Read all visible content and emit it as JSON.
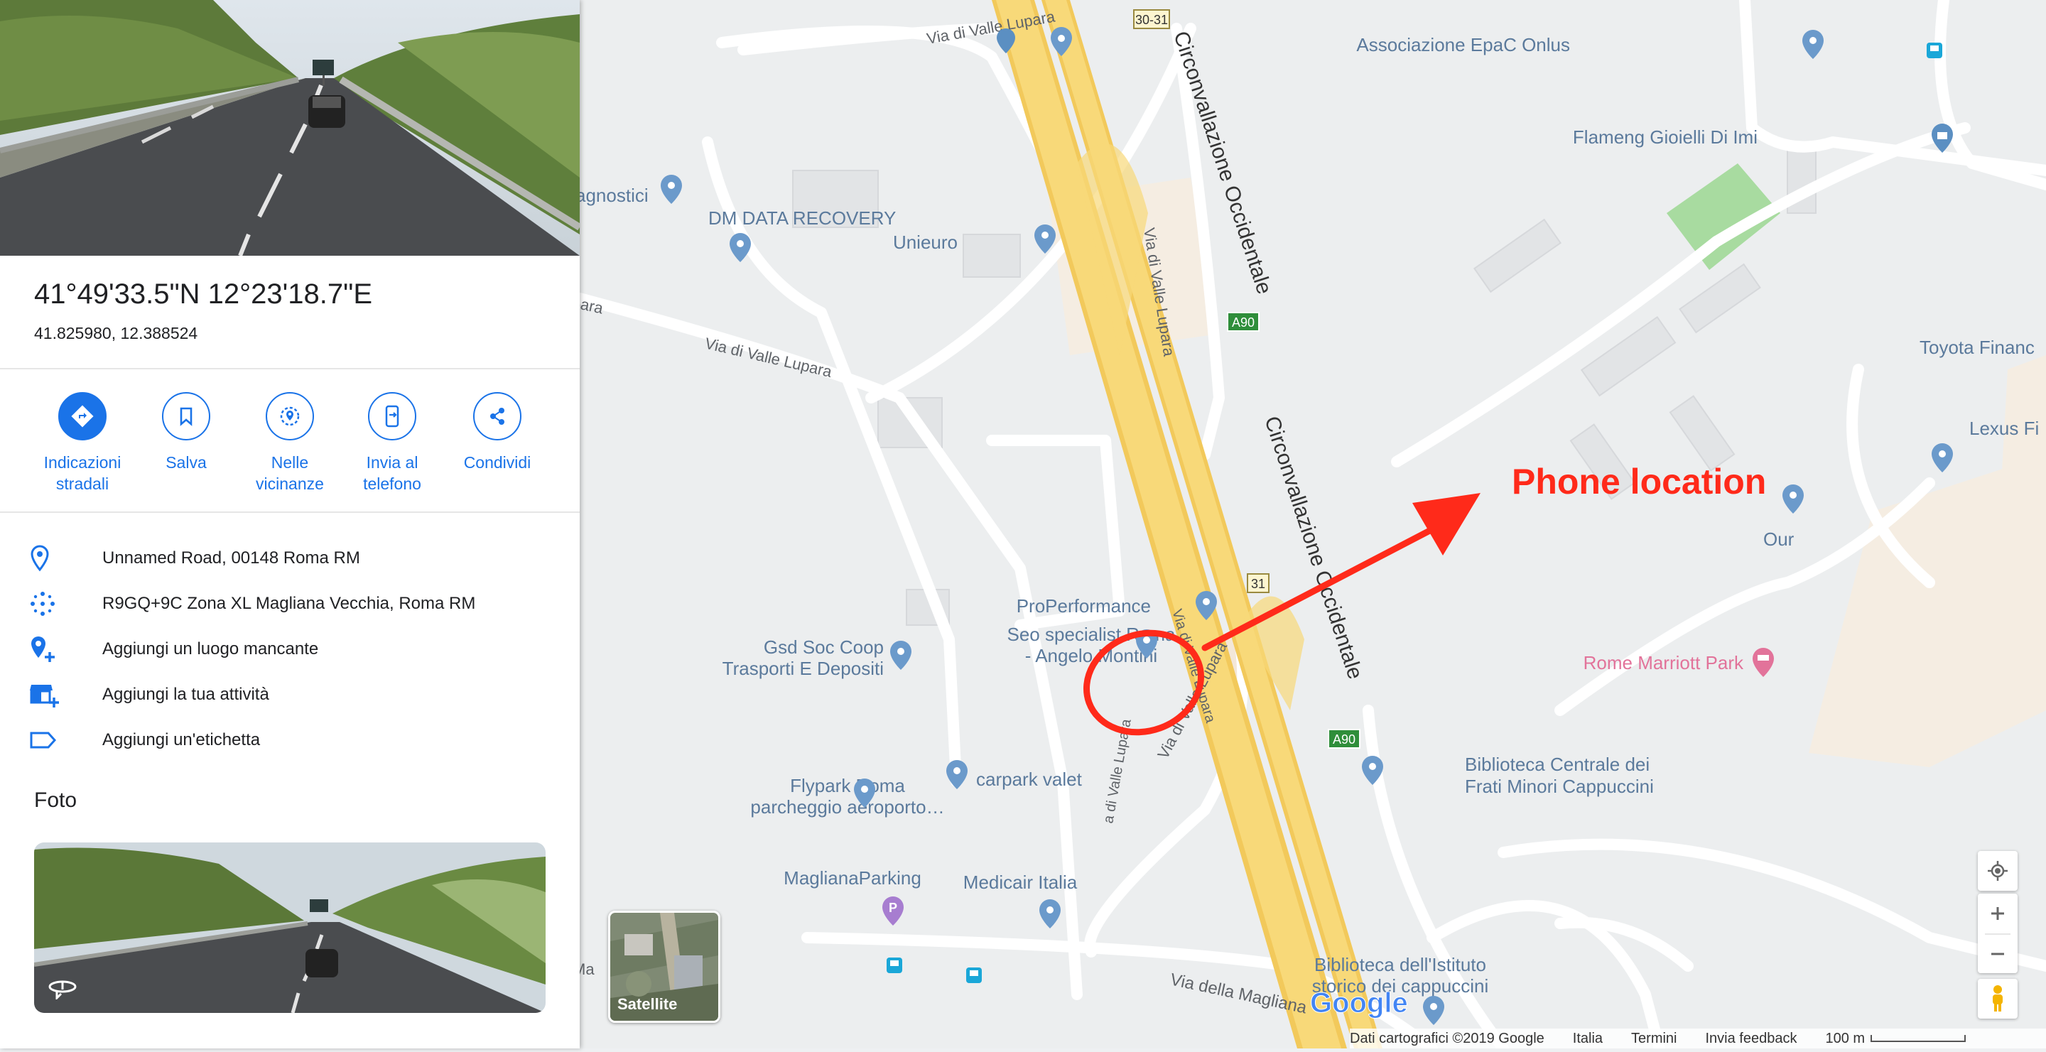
{
  "place": {
    "coordinates_dms": "41°49'33.5\"N 12°23'18.7\"E",
    "coordinates_decimal": "41.825980, 12.388524"
  },
  "actions": [
    {
      "label": "Indicazioni stradali",
      "icon": "directions-icon"
    },
    {
      "label": "Salva",
      "icon": "bookmark-icon"
    },
    {
      "label": "Nelle vicinanze",
      "icon": "nearby-icon"
    },
    {
      "label": "Invia al telefono",
      "icon": "send-to-phone-icon"
    },
    {
      "label": "Condividi",
      "icon": "share-icon"
    }
  ],
  "info": [
    {
      "text": "Unnamed Road, 00148 Roma RM",
      "icon": "location-pin-icon"
    },
    {
      "text": "R9GQ+9C Zona XL Magliana Vecchia, Roma RM",
      "icon": "plus-code-icon"
    },
    {
      "text": "Aggiungi un luogo mancante",
      "icon": "add-place-icon"
    },
    {
      "text": "Aggiungi la tua attività",
      "icon": "add-business-icon"
    },
    {
      "text": "Aggiungi un'etichetta",
      "icon": "label-icon"
    }
  ],
  "photos": {
    "title": "Foto"
  },
  "map": {
    "roads": {
      "via_valle_lupara": "Via di Valle Lupara",
      "circonvallazione": "Circonvallazione Occidentale",
      "via_magliana": "Via della Magliana",
      "fragment_ara": "ara",
      "fragment_agnostici": "agnostici"
    },
    "shields": {
      "exit_30_31": "30-31",
      "a90": "A90",
      "exit_31": "31"
    },
    "pois": {
      "associazione": "Associazione EpaC Onlus",
      "flameng": "Flameng Gioielli Di Imi",
      "dm_data": "DM DATA RECOVERY",
      "unieuro": "Unieuro",
      "toyota": "Toyota Financ",
      "lexus": "Lexus Fi",
      "our": "Our",
      "properformance": "ProPerformance",
      "seo_line1": "Seo specialist Roma",
      "seo_line2": "- Angelo Montini",
      "gsd_line1": "Gsd Soc Coop",
      "gsd_line2": "Trasporti E Depositi",
      "marriott": "Rome Marriott Park",
      "biblioteca_line1": "Biblioteca Centrale dei",
      "biblioteca_line2": "Frati Minori Cappuccini",
      "flypark_line1": "Flypark Roma",
      "flypark_line2": "parcheggio aeroporto…",
      "carpark": "carpark valet",
      "maglianaparking": "MaglianaParking",
      "medicair": "Medicair Italia",
      "bib_istituto_line1": "Biblioteca dell'Istituto",
      "bib_istituto_line2": "storico dei cappuccini"
    },
    "annotation": {
      "text": "Phone location",
      "color": "#ff2a1a"
    },
    "logo": "Google",
    "satellite_label": "Satellite",
    "footer": {
      "data": "Dati cartografici ©2019 Google",
      "country": "Italia",
      "terms": "Termini",
      "feedback": "Invia feedback",
      "scale": "100 m"
    }
  },
  "colors": {
    "accent": "#1a73e8",
    "highway": "#f8d979",
    "highway_edge": "#e8be50",
    "poi_blue": "#5b8fc2",
    "poi_pink": "#e2739a",
    "annotation_red": "#ff2a1a"
  }
}
